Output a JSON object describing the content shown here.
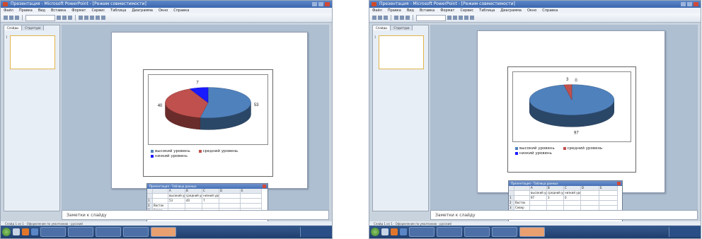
{
  "colors": {
    "series_1": "#4f81bd",
    "series_2": "#c0504d",
    "series_3": "#1a1aff"
  },
  "screens": [
    {
      "title": "Презентация - Microsoft PowerPoint - [Режим совместимости]",
      "menu": [
        "Файл",
        "Правка",
        "Вид",
        "Вставка",
        "Формат",
        "Сервис",
        "Таблица",
        "Диаграмма",
        "Окно",
        "Справка"
      ],
      "pane_tabs": [
        "Слайды",
        "Структура"
      ],
      "thumb_number": "1",
      "notes_placeholder": "Заметки к слайду",
      "status_text": "Слайд 1 из 1 · Оформление по умолчанию · русский",
      "chart_data": {
        "type": "pie",
        "categories": [
          "высокий уровень",
          "средний уровень",
          "низкий уровень"
        ],
        "values": [
          53,
          40,
          7
        ],
        "data_labels": [
          "53",
          "40",
          "7"
        ],
        "legend_position": "bottom",
        "three_d": true
      },
      "datasheet": {
        "title": "Презентация - Таблица данных",
        "columns": [
          "",
          "",
          "A",
          "B",
          "C",
          "D",
          "E"
        ],
        "rows": [
          [
            "",
            "",
            "высокий уровень",
            "средний уровень",
            "низкий уровень",
            "",
            ""
          ],
          [
            "1",
            "",
            "53",
            "40",
            "7",
            "",
            ""
          ],
          [
            "2",
            "Восток",
            "",
            "",
            "",
            "",
            ""
          ],
          [
            "3",
            "Север",
            "",
            "",
            "",
            "",
            ""
          ]
        ]
      }
    },
    {
      "title": "Презентация - Microsoft PowerPoint - [Режим совместимости]",
      "menu": [
        "Файл",
        "Правка",
        "Вид",
        "Вставка",
        "Формат",
        "Сервис",
        "Таблица",
        "Диаграмма",
        "Окно",
        "Справка"
      ],
      "pane_tabs": [
        "Слайды",
        "Структура"
      ],
      "thumb_number": "1",
      "notes_placeholder": "Заметки к слайду",
      "status_text": "Слайд 1 из 1 · Оформление по умолчанию · русский",
      "chart_data": {
        "type": "pie",
        "categories": [
          "высокий уровень",
          "средний уровень",
          "низкий уровень"
        ],
        "values": [
          97,
          3,
          0
        ],
        "data_labels": [
          "97",
          "3",
          "0"
        ],
        "legend_position": "bottom",
        "three_d": true
      },
      "datasheet": {
        "title": "Презентация - Таблица данных",
        "columns": [
          "",
          "",
          "A",
          "B",
          "C",
          "D",
          "E"
        ],
        "rows": [
          [
            "",
            "",
            "высокий уровень",
            "средний уровень",
            "низкий уровень",
            "",
            ""
          ],
          [
            "1",
            "",
            "97",
            "3",
            "0",
            "",
            ""
          ],
          [
            "2",
            "Восток",
            "",
            "",
            "",
            "",
            ""
          ],
          [
            "3",
            "Север",
            "",
            "",
            "",
            "",
            ""
          ]
        ]
      }
    }
  ]
}
